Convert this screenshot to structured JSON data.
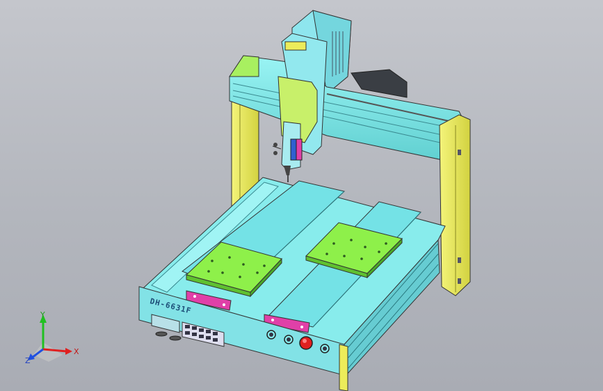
{
  "model": {
    "front_label": "DH-6631F"
  },
  "triad": {
    "x_label": "X",
    "y_label": "Y",
    "z_label": "Z",
    "x_color": "#e02020",
    "y_color": "#20c020",
    "z_color": "#2050e0"
  },
  "colors": {
    "body": "#7ee8e8",
    "frame_yellow": "#ecec5a",
    "fixture_green": "#8ef04a",
    "handle_magenta": "#e040a8",
    "estop_red": "#e02020",
    "display": "#b8e0e8"
  }
}
